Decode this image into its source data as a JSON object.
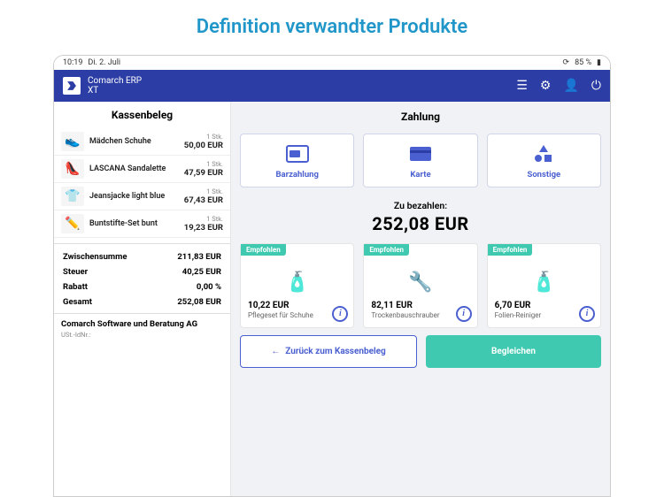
{
  "page_heading": "Definition verwandter Produkte",
  "statusbar": {
    "time": "10:19",
    "date": "Di. 2. Juli",
    "battery": "85 %"
  },
  "app": {
    "name_line1": "Comarch ERP",
    "name_line2": "XT"
  },
  "receipt": {
    "title": "Kassenbeleg",
    "items": [
      {
        "name": "Mädchen Schuhe",
        "qty": "1 Stk.",
        "price": "50,00 EUR",
        "emoji": "👟"
      },
      {
        "name": "LASCANA Sandalette",
        "qty": "1 Stk.",
        "price": "47,59 EUR",
        "emoji": "👠"
      },
      {
        "name": "Jeansjacke light blue",
        "qty": "1 Stk.",
        "price": "67,43 EUR",
        "emoji": "👕"
      },
      {
        "name": "Buntstifte-Set bunt",
        "qty": "1 Stk.",
        "price": "19,23 EUR",
        "emoji": "✏️"
      }
    ],
    "totals": {
      "subtotal_label": "Zwischensumme",
      "subtotal": "211,83 EUR",
      "tax_label": "Steuer",
      "tax": "40,25 EUR",
      "discount_label": "Rabatt",
      "discount": "0,00 %",
      "total_label": "Gesamt",
      "total": "252,08 EUR"
    },
    "company": "Comarch Software und Beratung AG",
    "ust_label": "USt.-IdNr.:"
  },
  "payment": {
    "title": "Zahlung",
    "options": {
      "cash": "Barzahlung",
      "card": "Karte",
      "other": "Sonstige"
    },
    "due_label": "Zu bezahlen:",
    "due_amount": "252,08 EUR"
  },
  "recommended": {
    "badge": "Empfohlen",
    "items": [
      {
        "price": "10,22 EUR",
        "name": "Pflegeset für Schuhe",
        "emoji": "🧴"
      },
      {
        "price": "82,11 EUR",
        "name": "Trockenbauschrauber",
        "emoji": "🔧"
      },
      {
        "price": "6,70 EUR",
        "name": "Folien-Reiniger",
        "emoji": "🧴"
      }
    ]
  },
  "actions": {
    "back": "Zurück zum Kassenbeleg",
    "settle": "Begleichen"
  }
}
